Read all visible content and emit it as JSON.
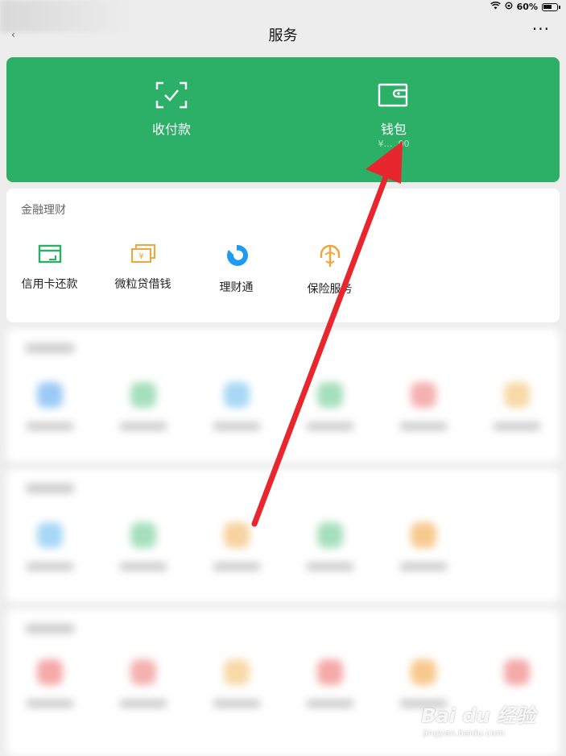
{
  "status_bar": {
    "battery": "60%"
  },
  "nav": {
    "title": "服务",
    "more": "···"
  },
  "top_card": {
    "items": [
      {
        "label": "收付款",
        "icon": "qr-scan-icon"
      },
      {
        "label": "钱包",
        "icon": "wallet-icon",
        "sub": "¥… .00"
      }
    ]
  },
  "finance": {
    "title": "金融理财",
    "items": [
      {
        "label": "信用卡还款",
        "icon": "credit-card-icon",
        "color": "#2cb067"
      },
      {
        "label": "微粒贷借钱",
        "icon": "loan-icon",
        "color": "#f2a53a"
      },
      {
        "label": "理财通",
        "icon": "wealth-icon",
        "color": "#1e9af0"
      },
      {
        "label": "保险服务",
        "icon": "insurance-icon",
        "color": "#f2a53a"
      }
    ]
  },
  "colors": {
    "accent": "#2cb067",
    "arrow": "#e8262e"
  },
  "watermark": {
    "main": "Bai du 经验",
    "sub": "jingyan.baidu.com"
  }
}
